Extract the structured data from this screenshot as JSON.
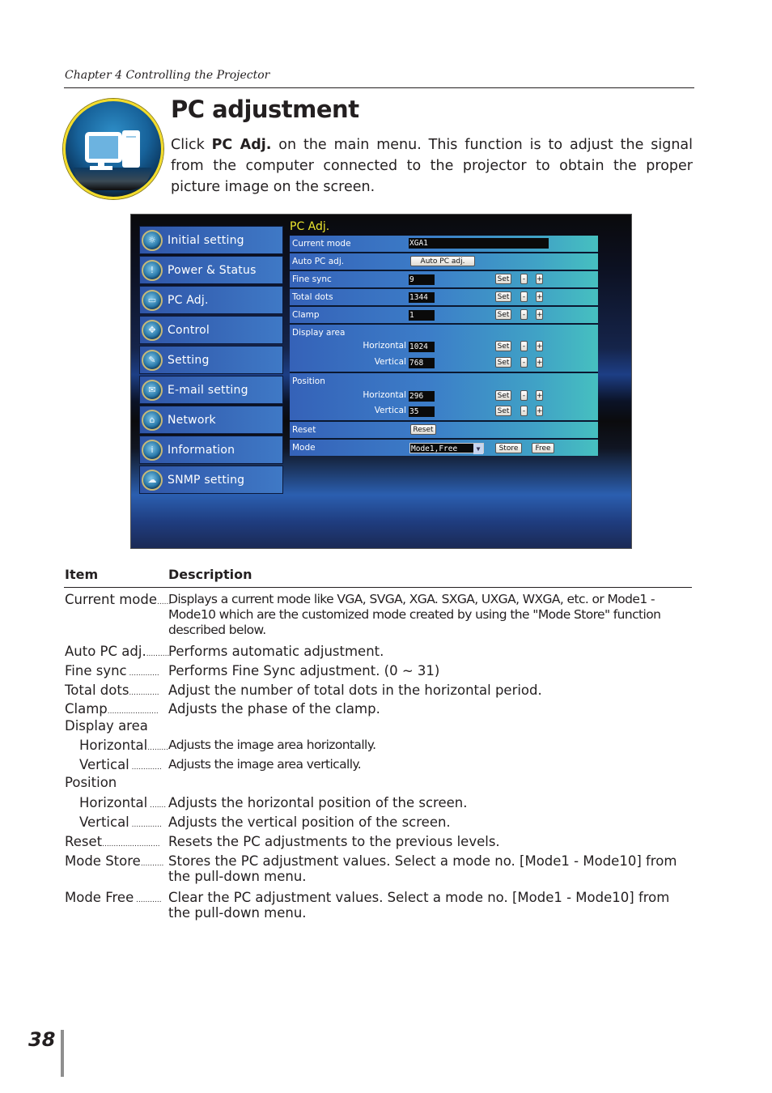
{
  "header": {
    "chapter": "Chapter 4 Controlling the Projector"
  },
  "section": {
    "title": "PC adjustment",
    "intro_prefix": "Click ",
    "intro_bold": "PC Adj.",
    "intro_suffix": " on the main menu. This function is to adjust the signal from the computer connected to the projector to obtain the proper picture image on the screen."
  },
  "screenshot": {
    "menu": [
      {
        "label": "Initial setting",
        "icon": "initial-setting-icon",
        "glyph": "☼"
      },
      {
        "label": "Power & Status",
        "icon": "power-status-icon",
        "glyph": "!"
      },
      {
        "label": "PC Adj.",
        "icon": "pc-adj-icon",
        "glyph": "▭"
      },
      {
        "label": "Control",
        "icon": "control-icon",
        "glyph": "✥"
      },
      {
        "label": "Setting",
        "icon": "setting-icon",
        "glyph": "✎"
      },
      {
        "label": "E-mail setting",
        "icon": "email-icon",
        "glyph": "✉"
      },
      {
        "label": "Network",
        "icon": "network-icon",
        "glyph": "⌂"
      },
      {
        "label": "Information",
        "icon": "information-icon",
        "glyph": "i"
      },
      {
        "label": "SNMP setting",
        "icon": "snmp-icon",
        "glyph": "☁"
      }
    ],
    "panel_title": "PC Adj.",
    "current_mode": {
      "label": "Current mode",
      "value": "XGA1"
    },
    "auto_pc": {
      "label": "Auto PC adj.",
      "button": "Auto PC adj."
    },
    "fine_sync": {
      "label": "Fine sync",
      "value": "9"
    },
    "total_dots": {
      "label": "Total dots",
      "value": "1344"
    },
    "clamp": {
      "label": "Clamp",
      "value": "1"
    },
    "display_area": {
      "label": "Display area",
      "horizontal": {
        "label": "Horizontal",
        "value": "1024"
      },
      "vertical": {
        "label": "Vertical",
        "value": "768"
      }
    },
    "position": {
      "label": "Position",
      "horizontal": {
        "label": "Horizontal",
        "value": "296"
      },
      "vertical": {
        "label": "Vertical",
        "value": "35"
      }
    },
    "reset": {
      "label": "Reset",
      "button": "Reset"
    },
    "mode": {
      "label": "Mode",
      "selected": "Mode1,Free",
      "store": "Store",
      "free": "Free"
    },
    "buttons": {
      "set": "Set",
      "minus": "-",
      "plus": "+"
    }
  },
  "table": {
    "col_item": "Item",
    "col_desc": "Description",
    "rows": [
      {
        "item": "Current mode",
        "dots": "......",
        "desc": "Displays a current mode like VGA, SVGA, XGA. SXGA, UXGA, WXGA, etc. or Mode1 - Mode10 which are the customized mode created by using the \"Mode Store\" function described below."
      },
      {
        "item": "Auto PC adj.",
        "dots": "..........",
        "desc": "Performs automatic adjustment."
      },
      {
        "item": "Fine sync",
        "dots": " .............",
        "desc": "Performs Fine Sync adjustment. (0 ~ 31)"
      },
      {
        "item": "Total dots",
        "dots": ".............",
        "desc": "Adjust the number of total dots in the horizontal period."
      },
      {
        "item": "Clamp",
        "dots": "......................",
        "desc": "Adjusts the phase of the clamp."
      },
      {
        "item": "Display area",
        "dots": "",
        "desc": ""
      },
      {
        "item": "Horizontal",
        "dots": ".........",
        "desc": "Adjusts the image area horizontally."
      },
      {
        "item": "Vertical",
        "dots": " .............",
        "desc": "Adjusts the image area vertically."
      },
      {
        "item": "Position",
        "dots": "",
        "desc": ""
      },
      {
        "item": "Horizontal",
        "dots": " .......",
        "desc": "Adjusts the horizontal position of the screen."
      },
      {
        "item": "Vertical",
        "dots": " .............",
        "desc": "Adjusts the vertical position of the screen."
      },
      {
        "item": "Reset",
        "dots": ".........................",
        "desc": "Resets the PC adjustments to the previous levels."
      },
      {
        "item": "Mode Store",
        "dots": "..........",
        "desc": "Stores the PC adjustment values. Select a mode no. [Mode1 - Mode10] from the pull-down menu."
      },
      {
        "item": "Mode Free",
        "dots": " ...........",
        "desc": "Clear the PC adjustment values. Select a mode no.  [Mode1 - Mode10] from the pull-down menu."
      }
    ]
  },
  "footer": {
    "page_number": "38"
  }
}
